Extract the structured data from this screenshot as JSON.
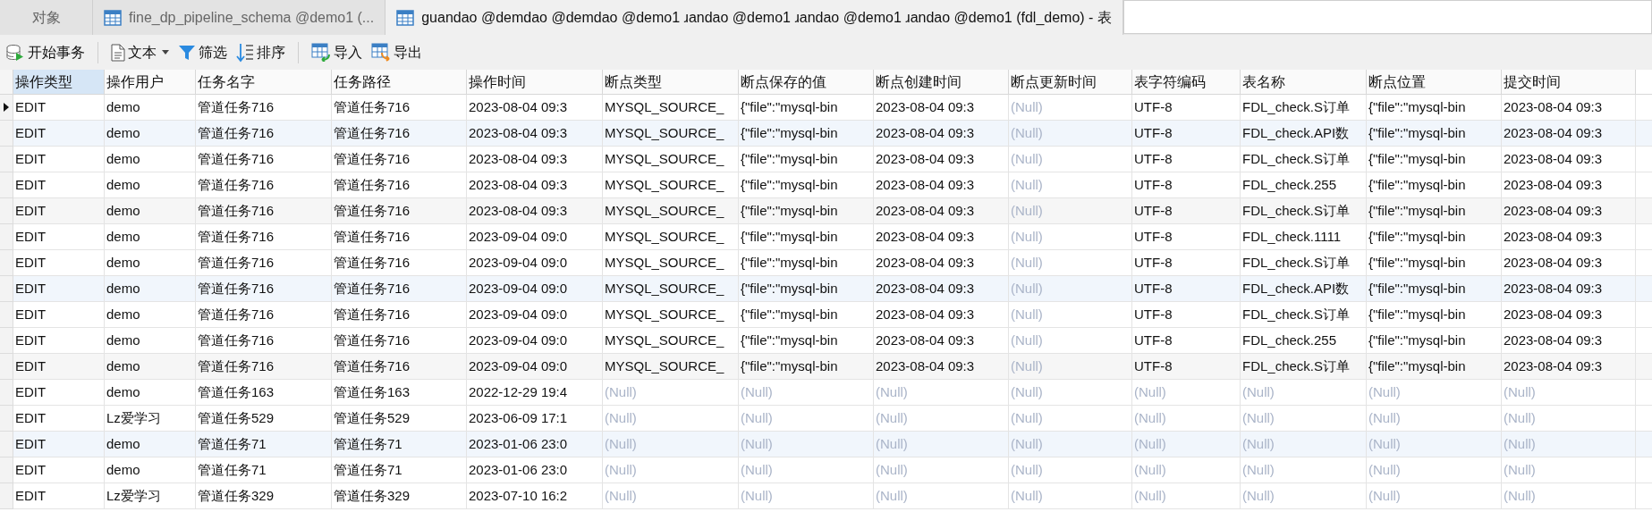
{
  "tabs": [
    {
      "kind": "plain",
      "label": "对象",
      "selected": false
    },
    {
      "kind": "table",
      "label": "fine_dp_pipeline_schema @demo1 (...",
      "selected": false
    },
    {
      "kind": "table",
      "label": "guandao @demdao @demdao @demo1 ɹandao @demo1 ɹandao @demo1 ɹandao @demo1 (fdl_demo) - 表",
      "selected": true
    }
  ],
  "toolbar": [
    {
      "kind": "transaction",
      "label": "开始事务"
    },
    {
      "kind": "separator"
    },
    {
      "kind": "text",
      "label": "文本",
      "dropdown": true
    },
    {
      "kind": "filter",
      "label": "筛选"
    },
    {
      "kind": "sort",
      "label": "排序"
    },
    {
      "kind": "separator"
    },
    {
      "kind": "import",
      "label": "导入"
    },
    {
      "kind": "export",
      "label": "导出"
    }
  ],
  "table": {
    "columns": [
      {
        "label": "操作类型",
        "selected": true
      },
      {
        "label": "操作用户",
        "selected": false
      },
      {
        "label": "任务名字",
        "selected": false
      },
      {
        "label": "任务路径",
        "selected": false
      },
      {
        "label": "操作时间",
        "selected": false
      },
      {
        "label": "断点类型",
        "selected": false
      },
      {
        "label": "断点保存的值",
        "selected": false
      },
      {
        "label": "断点创建时间",
        "selected": false
      },
      {
        "label": "断点更新时间",
        "selected": false
      },
      {
        "label": "表字符编码",
        "selected": false
      },
      {
        "label": "表名称",
        "selected": false
      },
      {
        "label": "断点位置",
        "selected": false
      },
      {
        "label": "提交时间",
        "selected": false
      }
    ],
    "rows": [
      {
        "current": true,
        "cells": [
          "EDIT",
          "demo",
          "管道任务716",
          "管道任务716",
          "2023-08-04 09:3",
          "MYSQL_SOURCE_",
          "{\"file\":\"mysql-bin",
          "2023-08-04 09:3",
          {
            "kind": "null",
            "text": "(Null)"
          },
          "UTF-8",
          "FDL_check.S订单",
          "{\"file\":\"mysql-bin",
          "2023-08-04 09:3"
        ]
      },
      {
        "current": false,
        "cells": [
          "EDIT",
          "demo",
          "管道任务716",
          "管道任务716",
          "2023-08-04 09:3",
          "MYSQL_SOURCE_",
          "{\"file\":\"mysql-bin",
          "2023-08-04 09:3",
          {
            "kind": "null",
            "text": "(Null)"
          },
          "UTF-8",
          "FDL_check.API数",
          "{\"file\":\"mysql-bin",
          "2023-08-04 09:3"
        ]
      },
      {
        "current": false,
        "cells": [
          "EDIT",
          "demo",
          "管道任务716",
          "管道任务716",
          "2023-08-04 09:3",
          "MYSQL_SOURCE_",
          "{\"file\":\"mysql-bin",
          "2023-08-04 09:3",
          {
            "kind": "null",
            "text": "(Null)"
          },
          "UTF-8",
          "FDL_check.S订单",
          "{\"file\":\"mysql-bin",
          "2023-08-04 09:3"
        ]
      },
      {
        "current": false,
        "cells": [
          "EDIT",
          "demo",
          "管道任务716",
          "管道任务716",
          "2023-08-04 09:3",
          "MYSQL_SOURCE_",
          "{\"file\":\"mysql-bin",
          "2023-08-04 09:3",
          {
            "kind": "null",
            "text": "(Null)"
          },
          "UTF-8",
          "FDL_check.255",
          "{\"file\":\"mysql-bin",
          "2023-08-04 09:3"
        ]
      },
      {
        "current": false,
        "cells": [
          "EDIT",
          "demo",
          "管道任务716",
          "管道任务716",
          "2023-08-04 09:3",
          "MYSQL_SOURCE_",
          "{\"file\":\"mysql-bin",
          "2023-08-04 09:3",
          {
            "kind": "null",
            "text": "(Null)"
          },
          "UTF-8",
          "FDL_check.S订单",
          "{\"file\":\"mysql-bin",
          "2023-08-04 09:3"
        ]
      },
      {
        "current": false,
        "cells": [
          "EDIT",
          "demo",
          "管道任务716",
          "管道任务716",
          "2023-09-04 09:0",
          "MYSQL_SOURCE_",
          "{\"file\":\"mysql-bin",
          "2023-08-04 09:3",
          {
            "kind": "null",
            "text": "(Null)"
          },
          "UTF-8",
          "FDL_check.1111",
          "{\"file\":\"mysql-bin",
          "2023-08-04 09:3"
        ]
      },
      {
        "current": false,
        "cells": [
          "EDIT",
          "demo",
          "管道任务716",
          "管道任务716",
          "2023-09-04 09:0",
          "MYSQL_SOURCE_",
          "{\"file\":\"mysql-bin",
          "2023-08-04 09:3",
          {
            "kind": "null",
            "text": "(Null)"
          },
          "UTF-8",
          "FDL_check.S订单",
          "{\"file\":\"mysql-bin",
          "2023-08-04 09:3"
        ]
      },
      {
        "current": false,
        "cells": [
          "EDIT",
          "demo",
          "管道任务716",
          "管道任务716",
          "2023-09-04 09:0",
          "MYSQL_SOURCE_",
          "{\"file\":\"mysql-bin",
          "2023-08-04 09:3",
          {
            "kind": "null",
            "text": "(Null)"
          },
          "UTF-8",
          "FDL_check.API数",
          "{\"file\":\"mysql-bin",
          "2023-08-04 09:3"
        ]
      },
      {
        "current": false,
        "cells": [
          "EDIT",
          "demo",
          "管道任务716",
          "管道任务716",
          "2023-09-04 09:0",
          "MYSQL_SOURCE_",
          "{\"file\":\"mysql-bin",
          "2023-08-04 09:3",
          {
            "kind": "null",
            "text": "(Null)"
          },
          "UTF-8",
          "FDL_check.S订单",
          "{\"file\":\"mysql-bin",
          "2023-08-04 09:3"
        ]
      },
      {
        "current": false,
        "cells": [
          "EDIT",
          "demo",
          "管道任务716",
          "管道任务716",
          "2023-09-04 09:0",
          "MYSQL_SOURCE_",
          "{\"file\":\"mysql-bin",
          "2023-08-04 09:3",
          {
            "kind": "null",
            "text": "(Null)"
          },
          "UTF-8",
          "FDL_check.255",
          "{\"file\":\"mysql-bin",
          "2023-08-04 09:3"
        ]
      },
      {
        "current": false,
        "cells": [
          "EDIT",
          "demo",
          "管道任务716",
          "管道任务716",
          "2023-09-04 09:0",
          "MYSQL_SOURCE_",
          "{\"file\":\"mysql-bin",
          "2023-08-04 09:3",
          {
            "kind": "null",
            "text": "(Null)"
          },
          "UTF-8",
          "FDL_check.S订单",
          "{\"file\":\"mysql-bin",
          "2023-08-04 09:3"
        ]
      },
      {
        "current": false,
        "cells": [
          "EDIT",
          "demo",
          "管道任务163",
          "管道任务163",
          "2022-12-29 19:4",
          {
            "kind": "null",
            "text": "(Null)"
          },
          {
            "kind": "null",
            "text": "(Null)"
          },
          {
            "kind": "null",
            "text": "(Null)"
          },
          {
            "kind": "null",
            "text": "(Null)"
          },
          {
            "kind": "null",
            "text": "(Null)"
          },
          {
            "kind": "null",
            "text": "(Null)"
          },
          {
            "kind": "null",
            "text": "(Null)"
          },
          {
            "kind": "null",
            "text": "(Null)"
          }
        ]
      },
      {
        "current": false,
        "cells": [
          "EDIT",
          "Lz爱学习",
          "管道任务529",
          "管道任务529",
          "2023-06-09 17:1",
          {
            "kind": "null",
            "text": "(Null)"
          },
          {
            "kind": "null",
            "text": "(Null)"
          },
          {
            "kind": "null",
            "text": "(Null)"
          },
          {
            "kind": "null",
            "text": "(Null)"
          },
          {
            "kind": "null",
            "text": "(Null)"
          },
          {
            "kind": "null",
            "text": "(Null)"
          },
          {
            "kind": "null",
            "text": "(Null)"
          },
          {
            "kind": "null",
            "text": "(Null)"
          }
        ]
      },
      {
        "current": false,
        "cells": [
          "EDIT",
          "demo",
          "管道任务71",
          "管道任务71",
          "2023-01-06 23:0",
          {
            "kind": "null",
            "text": "(Null)"
          },
          {
            "kind": "null",
            "text": "(Null)"
          },
          {
            "kind": "null",
            "text": "(Null)"
          },
          {
            "kind": "null",
            "text": "(Null)"
          },
          {
            "kind": "null",
            "text": "(Null)"
          },
          {
            "kind": "null",
            "text": "(Null)"
          },
          {
            "kind": "null",
            "text": "(Null)"
          },
          {
            "kind": "null",
            "text": "(Null)"
          }
        ]
      },
      {
        "current": false,
        "cells": [
          "EDIT",
          "demo",
          "管道任务71",
          "管道任务71",
          "2023-01-06 23:0",
          {
            "kind": "null",
            "text": "(Null)"
          },
          {
            "kind": "null",
            "text": "(Null)"
          },
          {
            "kind": "null",
            "text": "(Null)"
          },
          {
            "kind": "null",
            "text": "(Null)"
          },
          {
            "kind": "null",
            "text": "(Null)"
          },
          {
            "kind": "null",
            "text": "(Null)"
          },
          {
            "kind": "null",
            "text": "(Null)"
          },
          {
            "kind": "null",
            "text": "(Null)"
          }
        ]
      },
      {
        "current": false,
        "cells": [
          "EDIT",
          "Lz爱学习",
          "管道任务329",
          "管道任务329",
          "2023-07-10 16:2",
          {
            "kind": "null",
            "text": "(Null)"
          },
          {
            "kind": "null",
            "text": "(Null)"
          },
          {
            "kind": "null",
            "text": "(Null)"
          },
          {
            "kind": "null",
            "text": "(Null)"
          },
          {
            "kind": "null",
            "text": "(Null)"
          },
          {
            "kind": "null",
            "text": "(Null)"
          },
          {
            "kind": "null",
            "text": "(Null)"
          },
          {
            "kind": "null",
            "text": "(Null)"
          }
        ]
      }
    ]
  }
}
